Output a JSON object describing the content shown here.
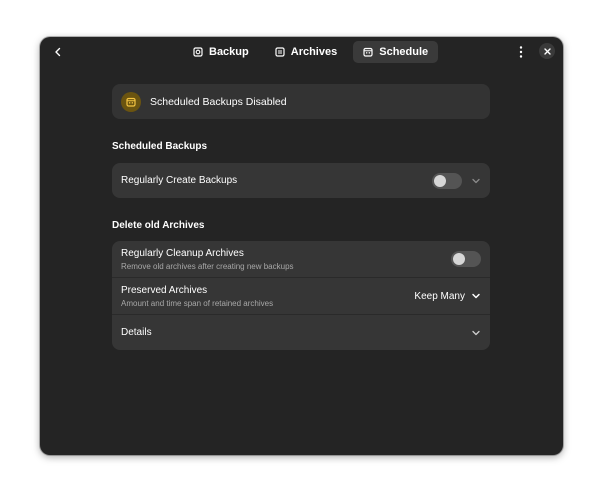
{
  "header": {
    "tabs": [
      {
        "label": "Backup",
        "icon": "backup-icon",
        "active": false
      },
      {
        "label": "Archives",
        "icon": "archives-icon",
        "active": false
      },
      {
        "label": "Schedule",
        "icon": "calendar-icon",
        "active": true
      }
    ]
  },
  "banner": {
    "text": "Scheduled Backups Disabled",
    "icon": "calendar-icon",
    "icon_color": "#6b5410"
  },
  "scheduled": {
    "title": "Scheduled Backups",
    "rows": [
      {
        "title": "Regularly Create Backups",
        "switch_on": false
      }
    ]
  },
  "delete_old": {
    "title": "Delete old Archives",
    "cleanup": {
      "title": "Regularly Cleanup Archives",
      "subtitle": "Remove old archives after creating new backups",
      "switch_on": false
    },
    "preserved": {
      "title": "Preserved Archives",
      "subtitle": "Amount and time span of retained archives",
      "value": "Keep Many"
    },
    "details": {
      "title": "Details"
    }
  },
  "colors": {
    "window_bg": "#242424",
    "card_bg": "#363636",
    "accent_banner": "#6b5410"
  }
}
